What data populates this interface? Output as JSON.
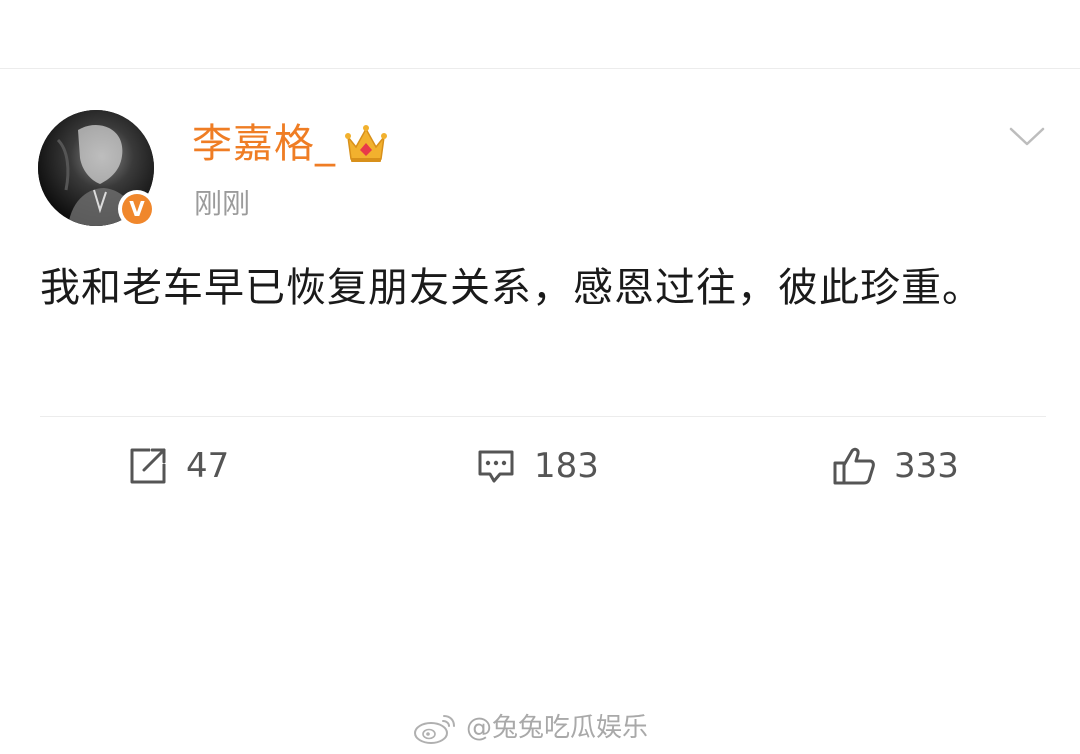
{
  "post": {
    "author": "李嘉格_",
    "timestamp": "刚刚",
    "text": "我和老车早已恢复朋友关系，感恩过往，彼此珍重。",
    "verified_mark": "V",
    "more_icon": "chevron-down-icon",
    "author_badge_icon": "crown-icon"
  },
  "actions": {
    "repost": {
      "icon": "share-icon",
      "count": "47"
    },
    "comment": {
      "icon": "comment-icon",
      "count": "183"
    },
    "like": {
      "icon": "thumbs-up-icon",
      "count": "333"
    }
  },
  "watermark": {
    "icon": "weibo-logo-icon",
    "text": "@兔兔吃瓜娱乐"
  },
  "colors": {
    "username": "#ef7d24",
    "verified": "#f0872c",
    "timestamp": "#9b9b9b",
    "text": "#1a1a1a",
    "action": "#555555"
  }
}
